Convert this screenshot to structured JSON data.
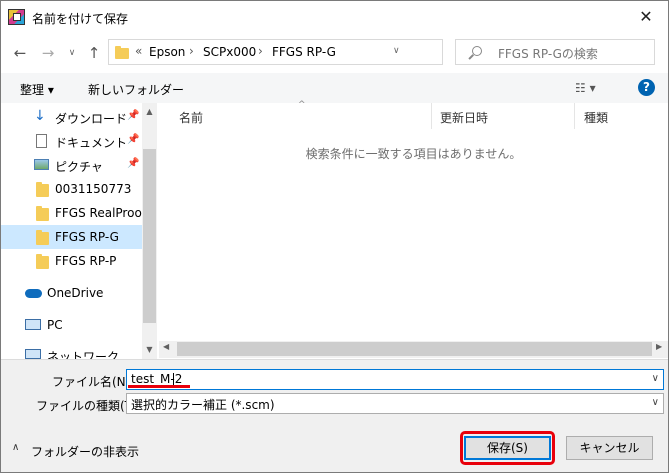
{
  "window": {
    "title": "名前を付けて保存",
    "close_glyph": "✕"
  },
  "nav": {
    "breadcrumb_prefix": "«",
    "path": [
      "Epson",
      "SCPx000",
      "FFGS RP-G"
    ],
    "search_placeholder": "FFGS RP-Gの検索"
  },
  "toolbar": {
    "organize_label": "整理 ▾",
    "new_folder_label": "新しいフォルダー",
    "help_label": "?"
  },
  "sidebar": {
    "items": [
      {
        "label": "ダウンロード",
        "icon": "download-arrow-icon",
        "pinned": true
      },
      {
        "label": "ドキュメント",
        "icon": "document-icon",
        "pinned": true
      },
      {
        "label": "ピクチャ",
        "icon": "picture-icon",
        "pinned": true
      },
      {
        "label": "0031150773",
        "icon": "folder-icon",
        "pinned": false
      },
      {
        "label": "FFGS RealProof C",
        "icon": "folder-icon",
        "pinned": false
      },
      {
        "label": "FFGS RP-G",
        "icon": "folder-icon",
        "pinned": false,
        "selected": true
      },
      {
        "label": "FFGS RP-P",
        "icon": "folder-icon",
        "pinned": false
      },
      {
        "label": "OneDrive",
        "icon": "cloud-icon",
        "pinned": false
      },
      {
        "label": "PC",
        "icon": "computer-icon",
        "pinned": false
      },
      {
        "label": "ネットワーク",
        "icon": "network-icon",
        "pinned": false
      }
    ]
  },
  "file_list": {
    "columns": [
      "名前",
      "更新日時",
      "種類"
    ],
    "empty_message": "検索条件に一致する項目はありません。"
  },
  "form": {
    "filename_label": "ファイル名(N):",
    "filename_value": "test_M-2",
    "filetype_label": "ファイルの種類(T):",
    "filetype_value": "選択的カラー補正 (*.scm)"
  },
  "footer": {
    "hide_folders_label": "フォルダーの非表示",
    "save_label": "保存(S)",
    "cancel_label": "キャンセル"
  },
  "colors": {
    "accent": "#0078d7",
    "selection": "#cce8ff",
    "highlight_red": "#e8000b",
    "folder": "#f5cc58"
  }
}
